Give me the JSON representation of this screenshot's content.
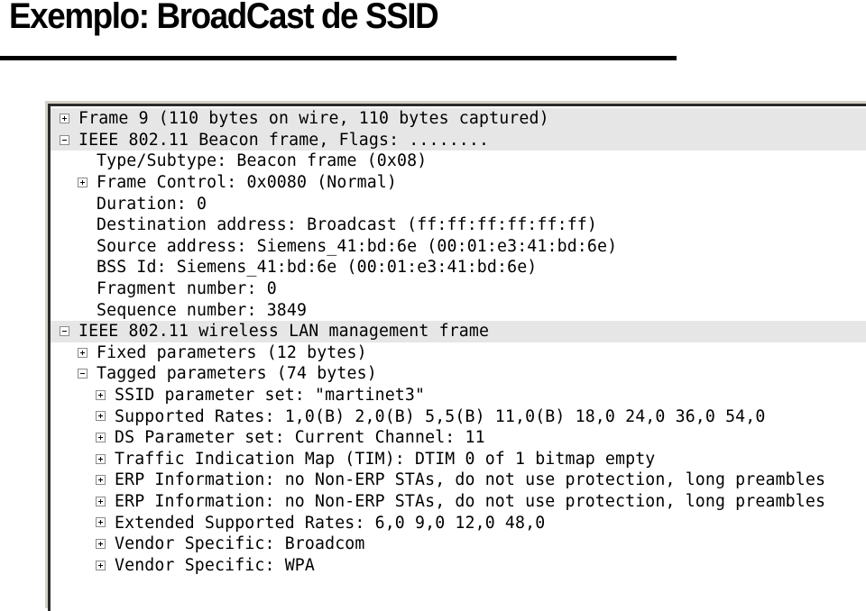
{
  "slide": {
    "title": "Exemplo: BroadCast de SSID"
  },
  "packet_tree": {
    "rows": [
      {
        "level": 0,
        "toggle": "plus",
        "selected": true,
        "label": "Frame 9 (110 bytes on wire, 110 bytes captured)"
      },
      {
        "level": 0,
        "toggle": "minus",
        "selected": true,
        "label": "IEEE 802.11 Beacon frame, Flags: ........"
      },
      {
        "level": 1,
        "toggle": "none",
        "selected": false,
        "label": "Type/Subtype: Beacon frame (0x08)"
      },
      {
        "level": 1,
        "toggle": "plus",
        "selected": false,
        "label": "Frame Control: 0x0080 (Normal)"
      },
      {
        "level": 1,
        "toggle": "none",
        "selected": false,
        "label": "Duration: 0"
      },
      {
        "level": 1,
        "toggle": "none",
        "selected": false,
        "label": "Destination address: Broadcast (ff:ff:ff:ff:ff:ff)"
      },
      {
        "level": 1,
        "toggle": "none",
        "selected": false,
        "label": "Source address: Siemens_41:bd:6e (00:01:e3:41:bd:6e)"
      },
      {
        "level": 1,
        "toggle": "none",
        "selected": false,
        "label": "BSS Id: Siemens_41:bd:6e (00:01:e3:41:bd:6e)"
      },
      {
        "level": 1,
        "toggle": "none",
        "selected": false,
        "label": "Fragment number: 0"
      },
      {
        "level": 1,
        "toggle": "none",
        "selected": false,
        "label": "Sequence number: 3849"
      },
      {
        "level": 0,
        "toggle": "minus",
        "selected": true,
        "label": "IEEE 802.11 wireless LAN management frame"
      },
      {
        "level": 1,
        "toggle": "plus",
        "selected": false,
        "label": "Fixed parameters (12 bytes)"
      },
      {
        "level": 1,
        "toggle": "minus",
        "selected": false,
        "label": "Tagged parameters (74 bytes)"
      },
      {
        "level": 2,
        "toggle": "plus",
        "selected": false,
        "label": "SSID parameter set: \"martinet3\""
      },
      {
        "level": 2,
        "toggle": "plus",
        "selected": false,
        "label": "Supported Rates: 1,0(B) 2,0(B) 5,5(B) 11,0(B) 18,0 24,0 36,0 54,0"
      },
      {
        "level": 2,
        "toggle": "plus",
        "selected": false,
        "label": "DS Parameter set: Current Channel: 11"
      },
      {
        "level": 2,
        "toggle": "plus",
        "selected": false,
        "label": "Traffic Indication Map (TIM): DTIM 0 of 1 bitmap empty"
      },
      {
        "level": 2,
        "toggle": "plus",
        "selected": false,
        "label": "ERP Information: no Non-ERP STAs, do not use protection, long preambles"
      },
      {
        "level": 2,
        "toggle": "plus",
        "selected": false,
        "label": "ERP Information: no Non-ERP STAs, do not use protection, long preambles"
      },
      {
        "level": 2,
        "toggle": "plus",
        "selected": false,
        "label": "Extended Supported Rates: 6,0 9,0 12,0 48,0"
      },
      {
        "level": 2,
        "toggle": "plus",
        "selected": false,
        "label": "Vendor Specific: Broadcom"
      },
      {
        "level": 2,
        "toggle": "plus",
        "selected": false,
        "label": "Vendor Specific: WPA"
      }
    ]
  },
  "colors": {
    "selected_row_bg": "#e6e6e6",
    "panel_border": "#2b2b2b",
    "text": "#000000"
  }
}
